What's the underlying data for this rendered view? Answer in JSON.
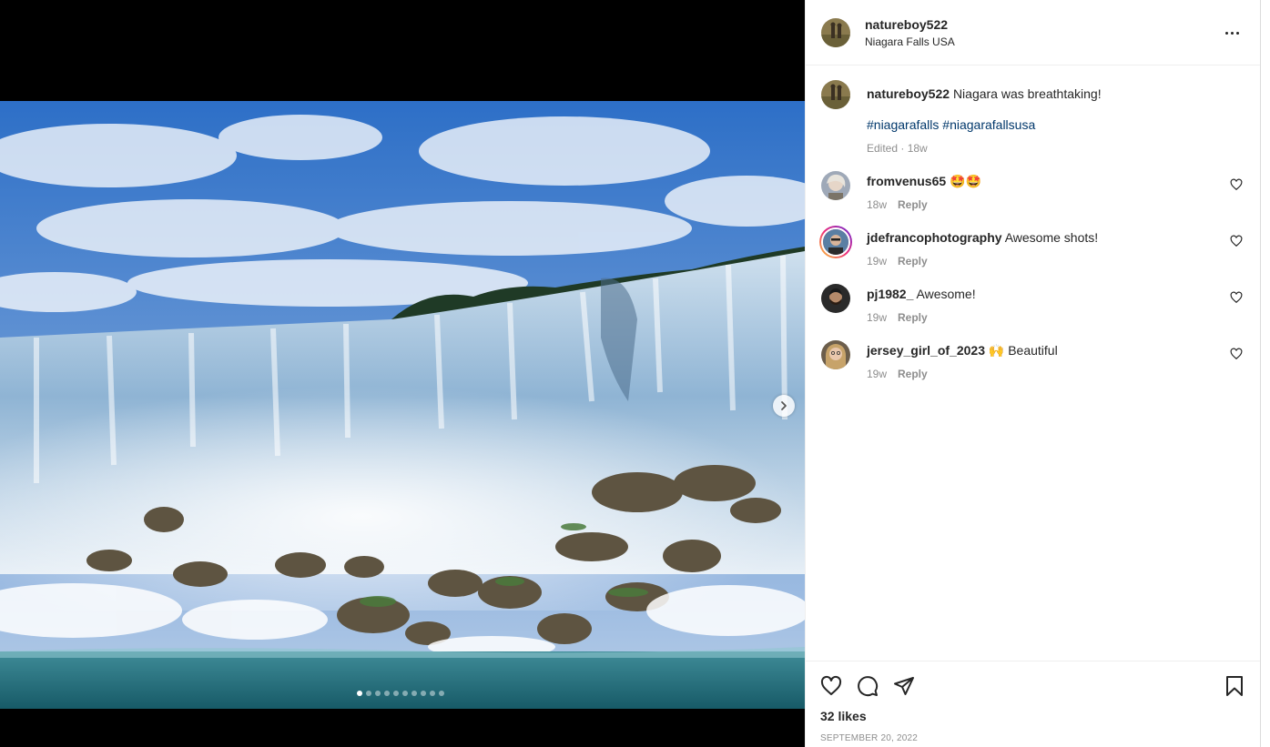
{
  "post": {
    "author": "natureboy522",
    "location": "Niagara Falls USA",
    "caption_text": "Niagara was breathtaking!",
    "hashtags": [
      "#niagarafalls",
      "#niagarafallsusa"
    ],
    "edited_time": "Edited · 18w",
    "likes": "32 likes",
    "date": "SEPTEMBER 20, 2022",
    "carousel": {
      "total": 10,
      "active_index": 0
    }
  },
  "comments": [
    {
      "username": "fromvenus65",
      "text": "🤩🤩",
      "time": "18w",
      "reply": "Reply"
    },
    {
      "username": "jdefrancophotography",
      "text": "Awesome shots!",
      "time": "19w",
      "reply": "Reply"
    },
    {
      "username": "pj1982_",
      "text": "Awesome!",
      "time": "19w",
      "reply": "Reply"
    },
    {
      "username": "jersey_girl_of_2023",
      "text": "🙌 Beautiful",
      "time": "19w",
      "reply": "Reply"
    }
  ],
  "icons": {
    "like": "heart-icon",
    "comment": "comment-icon",
    "share": "share-icon",
    "save": "bookmark-icon",
    "more": "more-options-icon",
    "next": "chevron-right-icon"
  },
  "colors": {
    "hashtag": "#00376b",
    "muted": "#8e8e8e",
    "text": "#262626"
  }
}
